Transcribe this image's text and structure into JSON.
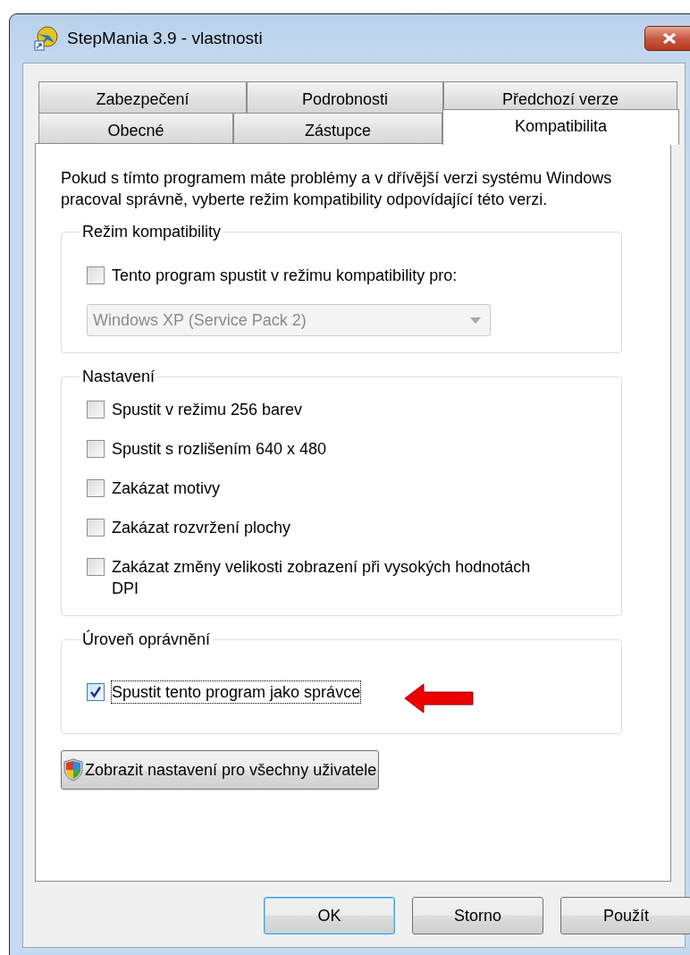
{
  "window": {
    "title": "StepMania 3.9 - vlastnosti"
  },
  "tab_rows": [
    {
      "tabs": [
        {
          "label": "Zabezpečení",
          "selected": false
        },
        {
          "label": "Podrobnosti",
          "selected": false
        },
        {
          "label": "Předchozí verze",
          "selected": false
        }
      ]
    },
    {
      "tabs": [
        {
          "label": "Obecné",
          "selected": false
        },
        {
          "label": "Zástupce",
          "selected": false
        },
        {
          "label": "Kompatibilita",
          "selected": true
        }
      ]
    }
  ],
  "description": "Pokud s tímto programem máte problémy a v dřívější verzi systému Windows pracoval správně, vyberte režim kompatibility odpovídající této verzi.",
  "groups": [
    {
      "title": "Režim kompatibility",
      "items": [
        {
          "kind": "checkbox",
          "label": "Tento program spustit v režimu kompatibility pro:",
          "checked": false,
          "focused": false
        },
        {
          "kind": "dropdown",
          "value": "Windows XP (Service Pack 2)",
          "disabled": true
        }
      ]
    },
    {
      "title": "Nastavení",
      "items": [
        {
          "kind": "checkbox",
          "label": "Spustit v režimu 256 barev",
          "checked": false,
          "focused": false
        },
        {
          "kind": "checkbox",
          "label": "Spustit s rozlišením 640 x 480",
          "checked": false,
          "focused": false
        },
        {
          "kind": "checkbox",
          "label": "Zakázat motivy",
          "checked": false,
          "focused": false
        },
        {
          "kind": "checkbox",
          "label": "Zakázat rozvržení plochy",
          "checked": false,
          "focused": false
        },
        {
          "kind": "checkbox",
          "label": "Zakázat změny velikosti zobrazení při vysokých hodnotách DPI",
          "checked": false,
          "focused": false
        }
      ]
    },
    {
      "title": "Úroveň oprávnění",
      "items": [
        {
          "kind": "checkbox",
          "label": "Spustit tento program jako správce",
          "checked": true,
          "focused": true
        }
      ]
    }
  ],
  "shield_button": {
    "label": "Zobrazit nastavení pro všechny uživatele"
  },
  "buttons": [
    {
      "label": "OK",
      "default": true
    },
    {
      "label": "Storno",
      "default": false
    },
    {
      "label": "Použít",
      "default": false
    }
  ]
}
